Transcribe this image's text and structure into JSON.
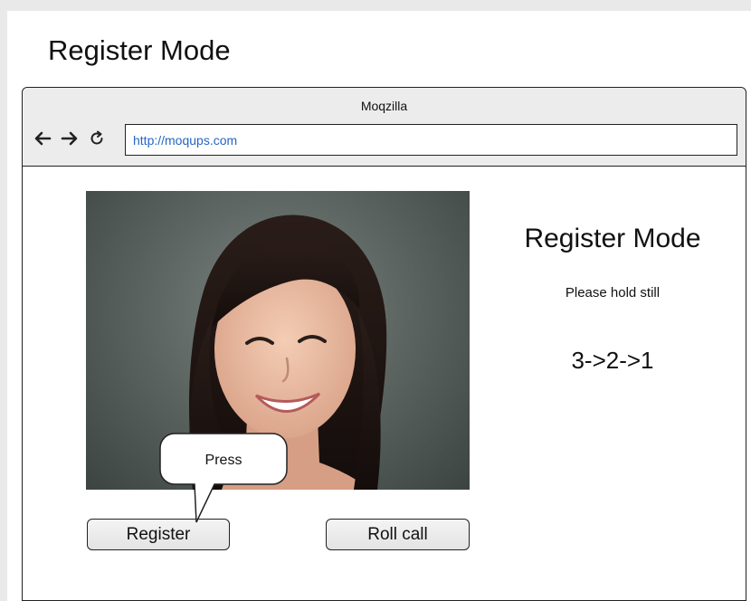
{
  "page": {
    "title": "Register Mode"
  },
  "browser": {
    "window_title": "Moqzilla",
    "url": "http://moqups.com",
    "nav_icons": [
      "back-arrow-icon",
      "forward-arrow-icon",
      "reload-icon"
    ]
  },
  "main": {
    "photo_alt": "Portrait of a smiling woman",
    "heading": "Register Mode",
    "instruction": "Please hold still",
    "countdown": "3->2->1"
  },
  "buttons": {
    "register": "Register",
    "roll_call": "Roll call"
  },
  "callout": {
    "text": "Press"
  },
  "colors": {
    "url_text": "#2466c4",
    "toolbar_bg": "#ececec",
    "canvas_bg": "#e9e9e9"
  }
}
